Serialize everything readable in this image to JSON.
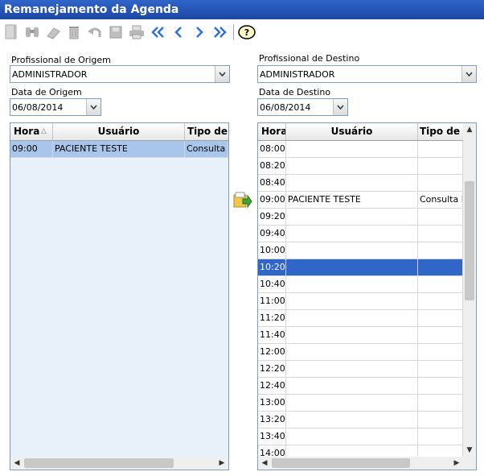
{
  "window": {
    "title": "Remanejamento da Agenda"
  },
  "toolbar": {
    "icons": [
      "new-icon",
      "binoculars-icon",
      "eraser-icon",
      "trash-icon",
      "undo-icon",
      "save-icon",
      "print-icon",
      "first-icon",
      "prev-icon",
      "next-icon",
      "last-icon",
      "help-icon"
    ],
    "help_label": "?"
  },
  "origem": {
    "prof_label": "Profissional de Origem",
    "prof_value": "ADMINISTRADOR",
    "date_label": "Data de Origem",
    "date_value": "06/08/2014",
    "columns": [
      "Hora",
      "Usuário",
      "Tipo de A"
    ],
    "sort_indicator": "△",
    "rows": [
      {
        "hora": "09:00",
        "usuario": "PACIENTE TESTE",
        "tipo": "Consulta P"
      }
    ]
  },
  "destino": {
    "prof_label": "Profissional de Destino",
    "prof_value": "ADMINISTRADOR",
    "date_label": "Data de Destino",
    "date_value": "06/08/2014",
    "columns": [
      "Hora",
      "Usuário",
      "Tipo de A"
    ],
    "rows": [
      {
        "hora": "08:00",
        "usuario": "",
        "tipo": ""
      },
      {
        "hora": "08:20",
        "usuario": "",
        "tipo": ""
      },
      {
        "hora": "08:40",
        "usuario": "",
        "tipo": ""
      },
      {
        "hora": "09:00",
        "usuario": "PACIENTE TESTE",
        "tipo": "Consulta P"
      },
      {
        "hora": "09:20",
        "usuario": "",
        "tipo": ""
      },
      {
        "hora": "09:40",
        "usuario": "",
        "tipo": ""
      },
      {
        "hora": "10:00",
        "usuario": "",
        "tipo": ""
      },
      {
        "hora": "10:20",
        "usuario": "",
        "tipo": ""
      },
      {
        "hora": "10:40",
        "usuario": "",
        "tipo": ""
      },
      {
        "hora": "11:00",
        "usuario": "",
        "tipo": ""
      },
      {
        "hora": "11:20",
        "usuario": "",
        "tipo": ""
      },
      {
        "hora": "11:40",
        "usuario": "",
        "tipo": ""
      },
      {
        "hora": "12:00",
        "usuario": "",
        "tipo": ""
      },
      {
        "hora": "12:20",
        "usuario": "",
        "tipo": ""
      },
      {
        "hora": "12:40",
        "usuario": "",
        "tipo": ""
      },
      {
        "hora": "13:00",
        "usuario": "",
        "tipo": ""
      },
      {
        "hora": "13:20",
        "usuario": "",
        "tipo": ""
      },
      {
        "hora": "13:40",
        "usuario": "",
        "tipo": ""
      },
      {
        "hora": "14:00",
        "usuario": "",
        "tipo": ""
      }
    ],
    "selected_hora": "10:20"
  },
  "colors": {
    "title_bg": "#2f66c8",
    "selected_row": "#2f66c8",
    "origin_selected_row": "#a8c6ec",
    "origin_grid_bg": "#e8f1fa"
  }
}
